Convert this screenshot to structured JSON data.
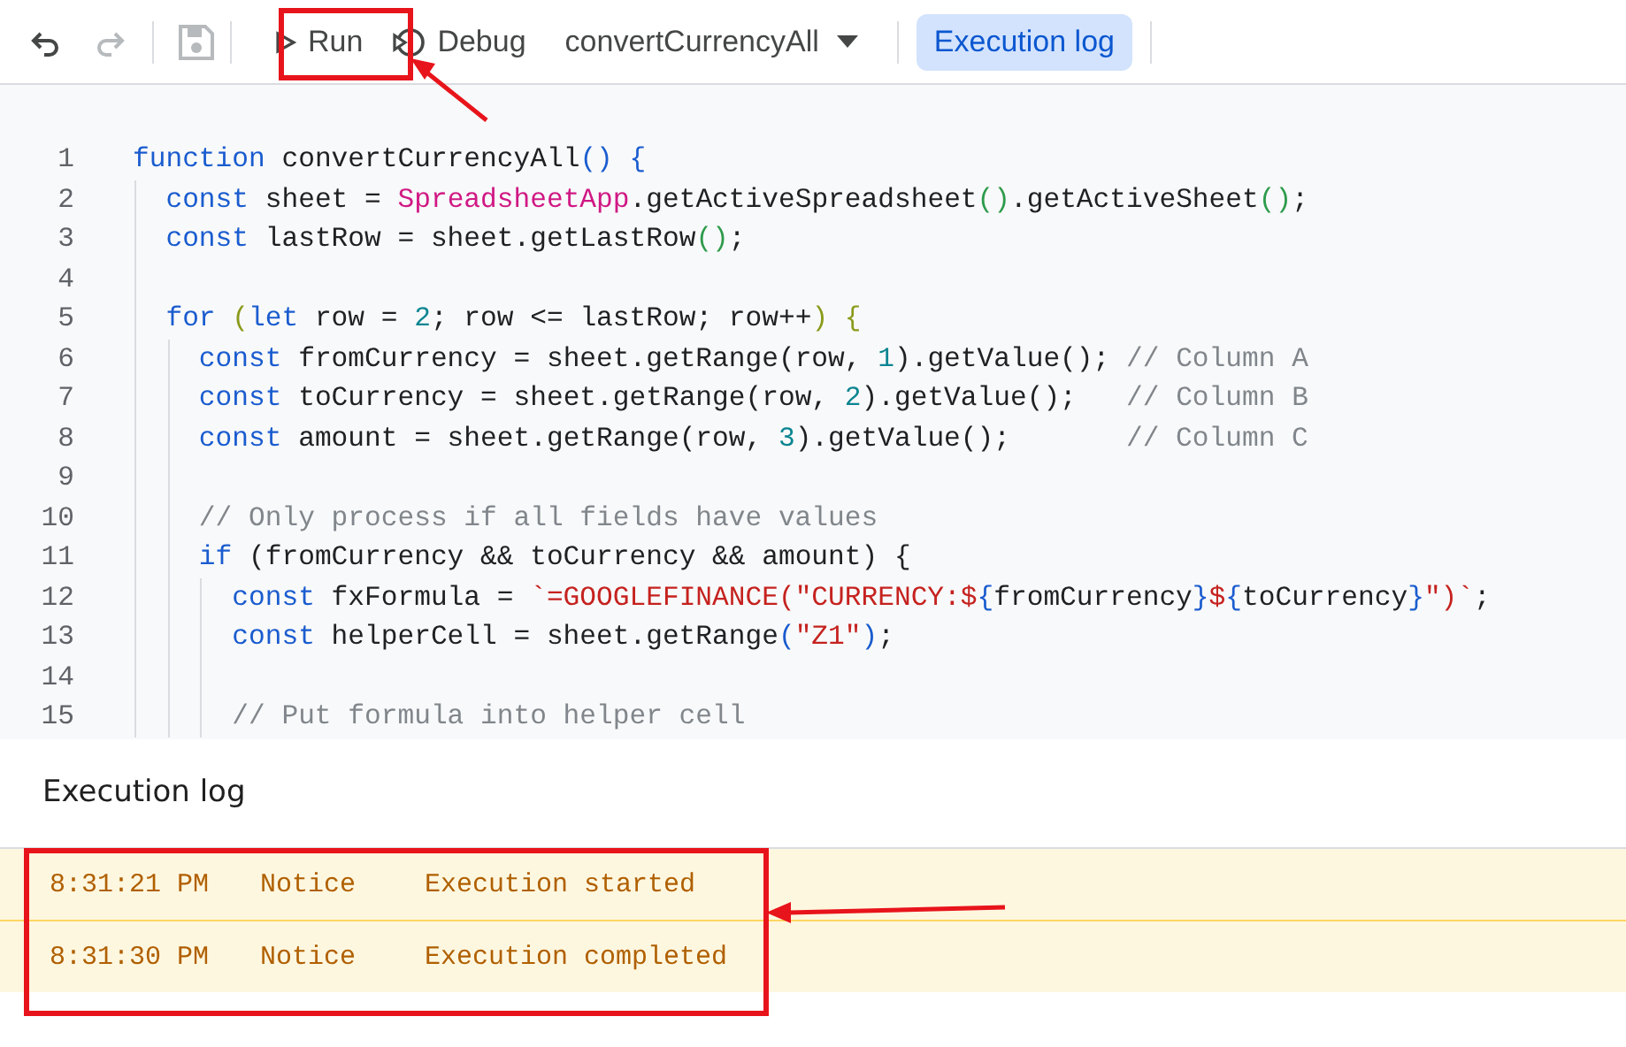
{
  "toolbar": {
    "undo": {
      "disabled": false
    },
    "redo": {
      "disabled": true
    },
    "save": {
      "disabled": true
    },
    "run": {
      "label": "Run"
    },
    "debug": {
      "label": "Debug"
    },
    "function_select": {
      "value": "convertCurrencyAll"
    },
    "execution_log_toggle": {
      "label": "Execution log",
      "selected": true
    }
  },
  "editor": {
    "lines": [
      {
        "number": "1",
        "tokens": [
          {
            "kind": "keyword",
            "text": "function"
          },
          {
            "kind": "plain",
            "text": " convertCurrencyAll"
          },
          {
            "kind": "bracket-a",
            "text": "()"
          },
          {
            "kind": "bracket-a",
            "text": " {"
          }
        ]
      },
      {
        "number": "2",
        "tokens": [
          {
            "kind": "keyword",
            "text": "  const"
          },
          {
            "kind": "plain",
            "text": " sheet = "
          },
          {
            "kind": "class",
            "text": "SpreadsheetApp"
          },
          {
            "kind": "plain",
            "text": ".getActiveSpreadsheet"
          },
          {
            "kind": "bracket-b",
            "text": "()"
          },
          {
            "kind": "plain",
            "text": ".getActiveSheet"
          },
          {
            "kind": "bracket-b",
            "text": "()"
          },
          {
            "kind": "plain",
            "text": ";"
          }
        ]
      },
      {
        "number": "3",
        "tokens": [
          {
            "kind": "keyword",
            "text": "  const"
          },
          {
            "kind": "plain",
            "text": " lastRow = sheet.getLastRow"
          },
          {
            "kind": "bracket-b",
            "text": "()"
          },
          {
            "kind": "plain",
            "text": ";"
          }
        ]
      },
      {
        "number": "4"
      },
      {
        "number": "5",
        "tokens": [
          {
            "kind": "keyword",
            "text": "  for"
          },
          {
            "kind": "bracket-c",
            "text": " ("
          },
          {
            "kind": "keyword",
            "text": "let"
          },
          {
            "kind": "plain",
            "text": " row = "
          },
          {
            "kind": "number",
            "text": "2"
          },
          {
            "kind": "plain",
            "text": "; row <= lastRow; row++"
          },
          {
            "kind": "bracket-c",
            "text": ")"
          },
          {
            "kind": "bracket-c",
            "text": " {"
          }
        ]
      },
      {
        "number": "6",
        "tokens": [
          {
            "kind": "keyword",
            "text": "    const"
          },
          {
            "kind": "plain",
            "text": " fromCurrency = sheet.getRange(row, "
          },
          {
            "kind": "number",
            "text": "1"
          },
          {
            "kind": "plain",
            "text": ").getValue(); "
          },
          {
            "kind": "comment",
            "text": "// Column A"
          }
        ]
      },
      {
        "number": "7",
        "tokens": [
          {
            "kind": "keyword",
            "text": "    const"
          },
          {
            "kind": "plain",
            "text": " toCurrency = sheet.getRange(row, "
          },
          {
            "kind": "number",
            "text": "2"
          },
          {
            "kind": "plain",
            "text": ").getValue();   "
          },
          {
            "kind": "comment",
            "text": "// Column B"
          }
        ]
      },
      {
        "number": "8",
        "tokens": [
          {
            "kind": "keyword",
            "text": "    const"
          },
          {
            "kind": "plain",
            "text": " amount = sheet.getRange(row, "
          },
          {
            "kind": "number",
            "text": "3"
          },
          {
            "kind": "plain",
            "text": ").getValue();       "
          },
          {
            "kind": "comment",
            "text": "// Column C"
          }
        ]
      },
      {
        "number": "9"
      },
      {
        "number": "10",
        "tokens": [
          {
            "kind": "comment",
            "text": "    // Only process if all fields have values"
          }
        ]
      },
      {
        "number": "11",
        "tokens": [
          {
            "kind": "keyword",
            "text": "    if"
          },
          {
            "kind": "plain",
            "text": " (fromCurrency && toCurrency && amount) {"
          }
        ]
      },
      {
        "number": "12",
        "tokens": [
          {
            "kind": "keyword",
            "text": "      const"
          },
          {
            "kind": "plain",
            "text": " fxFormula = "
          },
          {
            "kind": "string",
            "text": "`=GOOGLEFINANCE(\"CURRENCY:$"
          },
          {
            "kind": "interpolation",
            "text": "{"
          },
          {
            "kind": "plain",
            "text": "fromCurrency"
          },
          {
            "kind": "interpolation",
            "text": "}"
          },
          {
            "kind": "string",
            "text": "$"
          },
          {
            "kind": "interpolation",
            "text": "{"
          },
          {
            "kind": "plain",
            "text": "toCurrency"
          },
          {
            "kind": "interpolation",
            "text": "}"
          },
          {
            "kind": "string",
            "text": "\")`"
          },
          {
            "kind": "plain",
            "text": ";"
          }
        ]
      },
      {
        "number": "13",
        "tokens": [
          {
            "kind": "keyword",
            "text": "      const"
          },
          {
            "kind": "plain",
            "text": " helperCell = sheet.getRange"
          },
          {
            "kind": "bracket-a",
            "text": "("
          },
          {
            "kind": "string",
            "text": "\"Z1\""
          },
          {
            "kind": "bracket-a",
            "text": ")"
          },
          {
            "kind": "plain",
            "text": ";"
          }
        ]
      },
      {
        "number": "14"
      },
      {
        "number": "15",
        "tokens": [
          {
            "kind": "comment",
            "text": "      // Put formula into helper cell"
          }
        ]
      }
    ]
  },
  "execution_log": {
    "title": "Execution log",
    "entries": [
      {
        "time": "8:31:21 PM",
        "level": "Notice",
        "message": "Execution started"
      },
      {
        "time": "8:31:30 PM",
        "level": "Notice",
        "message": "Execution completed"
      }
    ]
  }
}
